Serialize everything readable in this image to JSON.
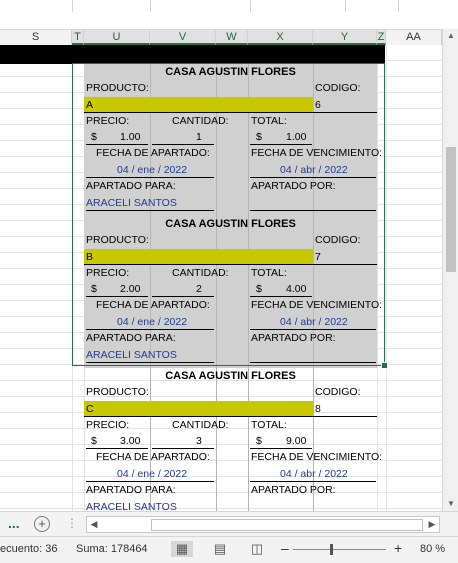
{
  "columns": {
    "s": "S",
    "t": "T",
    "u": "U",
    "v": "V",
    "w": "W",
    "x": "X",
    "y": "Y",
    "z": "Z",
    "aa": "AA"
  },
  "cards": [
    {
      "title": "CASA AGUSTIN FLORES",
      "producto_label": "PRODUCTO:",
      "codigo_label": "CODIGO:",
      "producto_value": "A",
      "codigo_value": "6",
      "precio_label": "PRECIO:",
      "cantidad_label": "CANTIDAD:",
      "total_label": "TOTAL:",
      "precio_currency": "$",
      "precio_value": "1.00",
      "cantidad_value": "1",
      "total_currency": "$",
      "total_value": "1.00",
      "fecha_apartado_label": "FECHA DE APARTADO:",
      "fecha_vencimiento_label": "FECHA DE VENCIMIENTO:",
      "fecha_apartado_value": "04 / ene / 2022",
      "fecha_vencimiento_value": "04 / abr / 2022",
      "apartado_para_label": "APARTADO PARA:",
      "apartado_por_label": "APARTADO POR:",
      "apartado_para_value": "ARACELI SANTOS"
    },
    {
      "title": "CASA AGUSTIN FLORES",
      "producto_label": "PRODUCTO:",
      "codigo_label": "CODIGO:",
      "producto_value": "B",
      "codigo_value": "7",
      "precio_label": "PRECIO:",
      "cantidad_label": "CANTIDAD:",
      "total_label": "TOTAL:",
      "precio_currency": "$",
      "precio_value": "2.00",
      "cantidad_value": "2",
      "total_currency": "$",
      "total_value": "4.00",
      "fecha_apartado_label": "FECHA DE APARTADO:",
      "fecha_vencimiento_label": "FECHA DE VENCIMIENTO:",
      "fecha_apartado_value": "04 / ene / 2022",
      "fecha_vencimiento_value": "04 / abr / 2022",
      "apartado_para_label": "APARTADO PARA:",
      "apartado_por_label": "APARTADO POR:",
      "apartado_para_value": "ARACELI SANTOS"
    },
    {
      "title": "CASA AGUSTIN FLORES",
      "producto_label": "PRODUCTO:",
      "codigo_label": "CODIGO:",
      "producto_value": "C",
      "codigo_value": "8",
      "precio_label": "PRECIO:",
      "cantidad_label": "CANTIDAD:",
      "total_label": "TOTAL:",
      "precio_currency": "$",
      "precio_value": "3.00",
      "cantidad_value": "3",
      "total_currency": "$",
      "total_value": "9.00",
      "fecha_apartado_label": "FECHA DE APARTADO:",
      "fecha_vencimiento_label": "FECHA DE VENCIMIENTO:",
      "fecha_apartado_value": "04 / ene / 2022",
      "fecha_vencimiento_value": "04 / abr / 2022",
      "apartado_para_label": "APARTADO PARA:",
      "apartado_por_label": "APARTADO POR:",
      "apartado_para_value": "ARACELI SANTOS"
    }
  ],
  "statusbar": {
    "recuento": "ecuento: 36",
    "suma": "Suma: 178464",
    "zoom_minus": "–",
    "zoom_plus": "+",
    "zoom_level": "80 %"
  },
  "sheetbar": {
    "dots": "...",
    "add": "+",
    "scroll_left": "◀",
    "scroll_right": "▶"
  },
  "vscroll": {
    "up": "▲",
    "down": "▼"
  },
  "icons": {
    "normal_view": "normal-view-icon",
    "page_layout": "page-layout-icon",
    "page_break": "page-break-preview-icon"
  },
  "colors": {
    "accent": "#217346",
    "highlight": "#c8c800",
    "card_gray": "#d0d0d0",
    "value_blue": "#1f3a93"
  }
}
